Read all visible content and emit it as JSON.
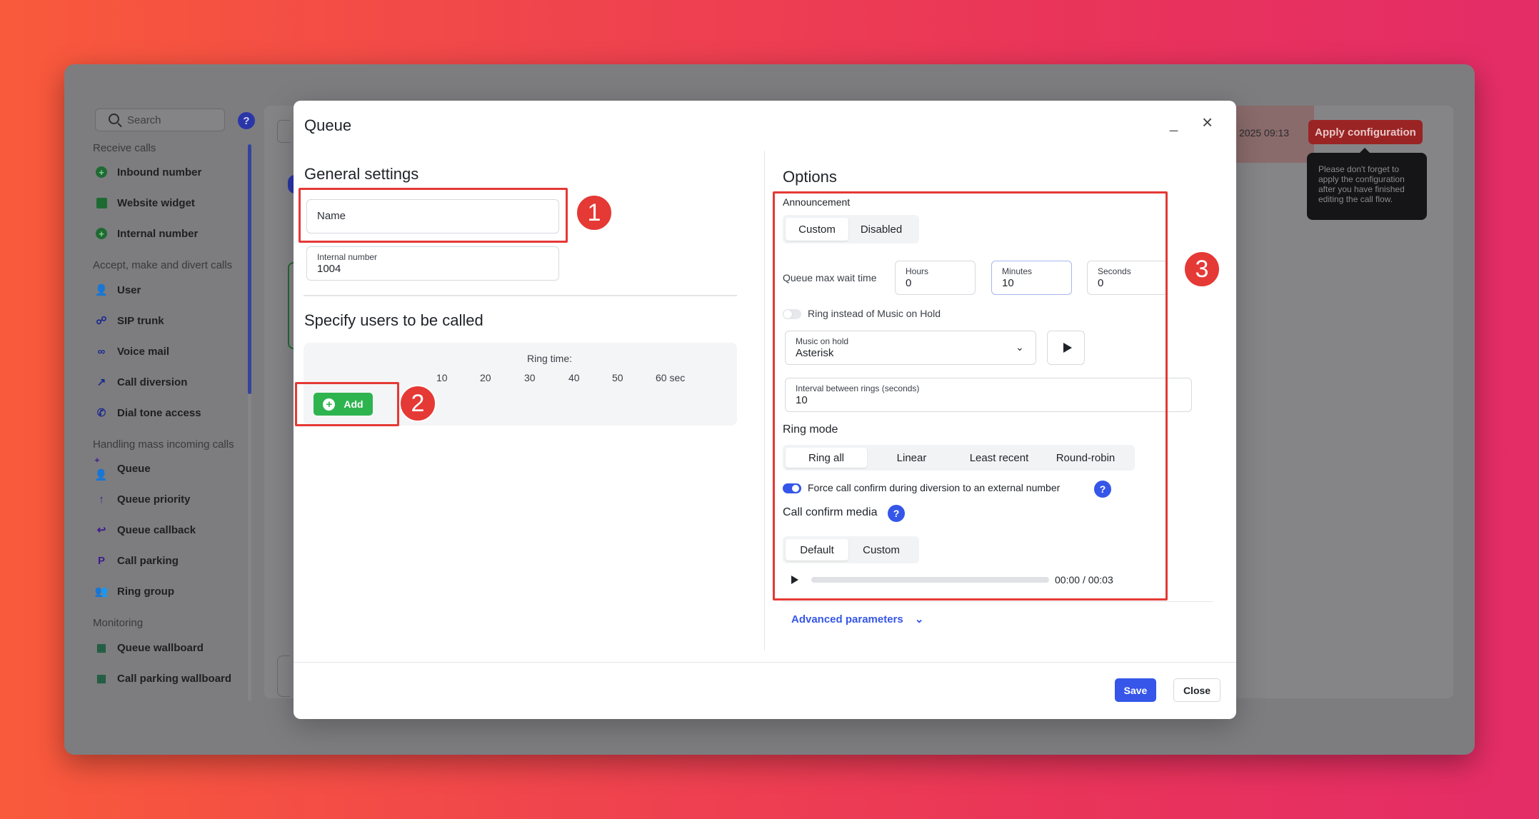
{
  "sidebar": {
    "search_placeholder": "Search",
    "help": "?",
    "sections": [
      {
        "title": "Receive calls",
        "items": [
          "Inbound number",
          "Website widget",
          "Internal number"
        ]
      },
      {
        "title": "Accept, make and divert calls",
        "items": [
          "User",
          "SIP trunk",
          "Voice mail",
          "Call diversion",
          "Dial tone access"
        ]
      },
      {
        "title": "Handling mass incoming calls",
        "items": [
          "Queue",
          "Queue priority",
          "Queue callback",
          "Call parking",
          "Ring group"
        ]
      },
      {
        "title": "Monitoring",
        "items": [
          "Queue wallboard",
          "Call parking wallboard"
        ]
      }
    ]
  },
  "header": {
    "date": "2025 09:13",
    "apply_label": "Apply configuration",
    "tooltip": "Please don't forget to apply the configuration after you have finished editing the call flow."
  },
  "dialog": {
    "title": "Queue",
    "minimize": "_",
    "close": "×",
    "general": {
      "heading": "General settings",
      "name_placeholder": "Name",
      "internal_label": "Internal number",
      "internal_value": "1004"
    },
    "users": {
      "heading": "Specify users to be called",
      "ring_time_label": "Ring time:",
      "ticks": [
        "10",
        "20",
        "30",
        "40",
        "50",
        "60 sec"
      ],
      "add_label": "Add"
    },
    "options": {
      "heading": "Options",
      "announcement_label": "Announcement",
      "announcement_options": [
        "Custom",
        "Disabled"
      ],
      "wait_label": "Queue max wait time",
      "hours_label": "Hours",
      "hours_value": "0",
      "minutes_label": "Minutes",
      "minutes_value": "10",
      "seconds_label": "Seconds",
      "seconds_value": "0",
      "ring_instead_label": "Ring instead of Music on Hold",
      "moh_label": "Music on hold",
      "moh_value": "Asterisk",
      "interval_label": "Interval between rings (seconds)",
      "interval_value": "10",
      "ring_mode_label": "Ring mode",
      "ring_modes": [
        "Ring all",
        "Linear",
        "Least recent",
        "Round-robin"
      ],
      "force_confirm_label": "Force call confirm during diversion to an external number",
      "confirm_media_label": "Call confirm media",
      "confirm_media_options": [
        "Default",
        "Custom"
      ],
      "audio_current": "00:00",
      "audio_sep": "/",
      "audio_total": "00:03",
      "advanced_label": "Advanced parameters"
    },
    "save_label": "Save",
    "close_label": "Close"
  },
  "annotations": [
    "1",
    "2",
    "3"
  ],
  "colors": {
    "accent": "#3556e8",
    "add_green": "#2eb44f",
    "highlight_red": "#e53935",
    "apply_red": "#9a2424"
  }
}
